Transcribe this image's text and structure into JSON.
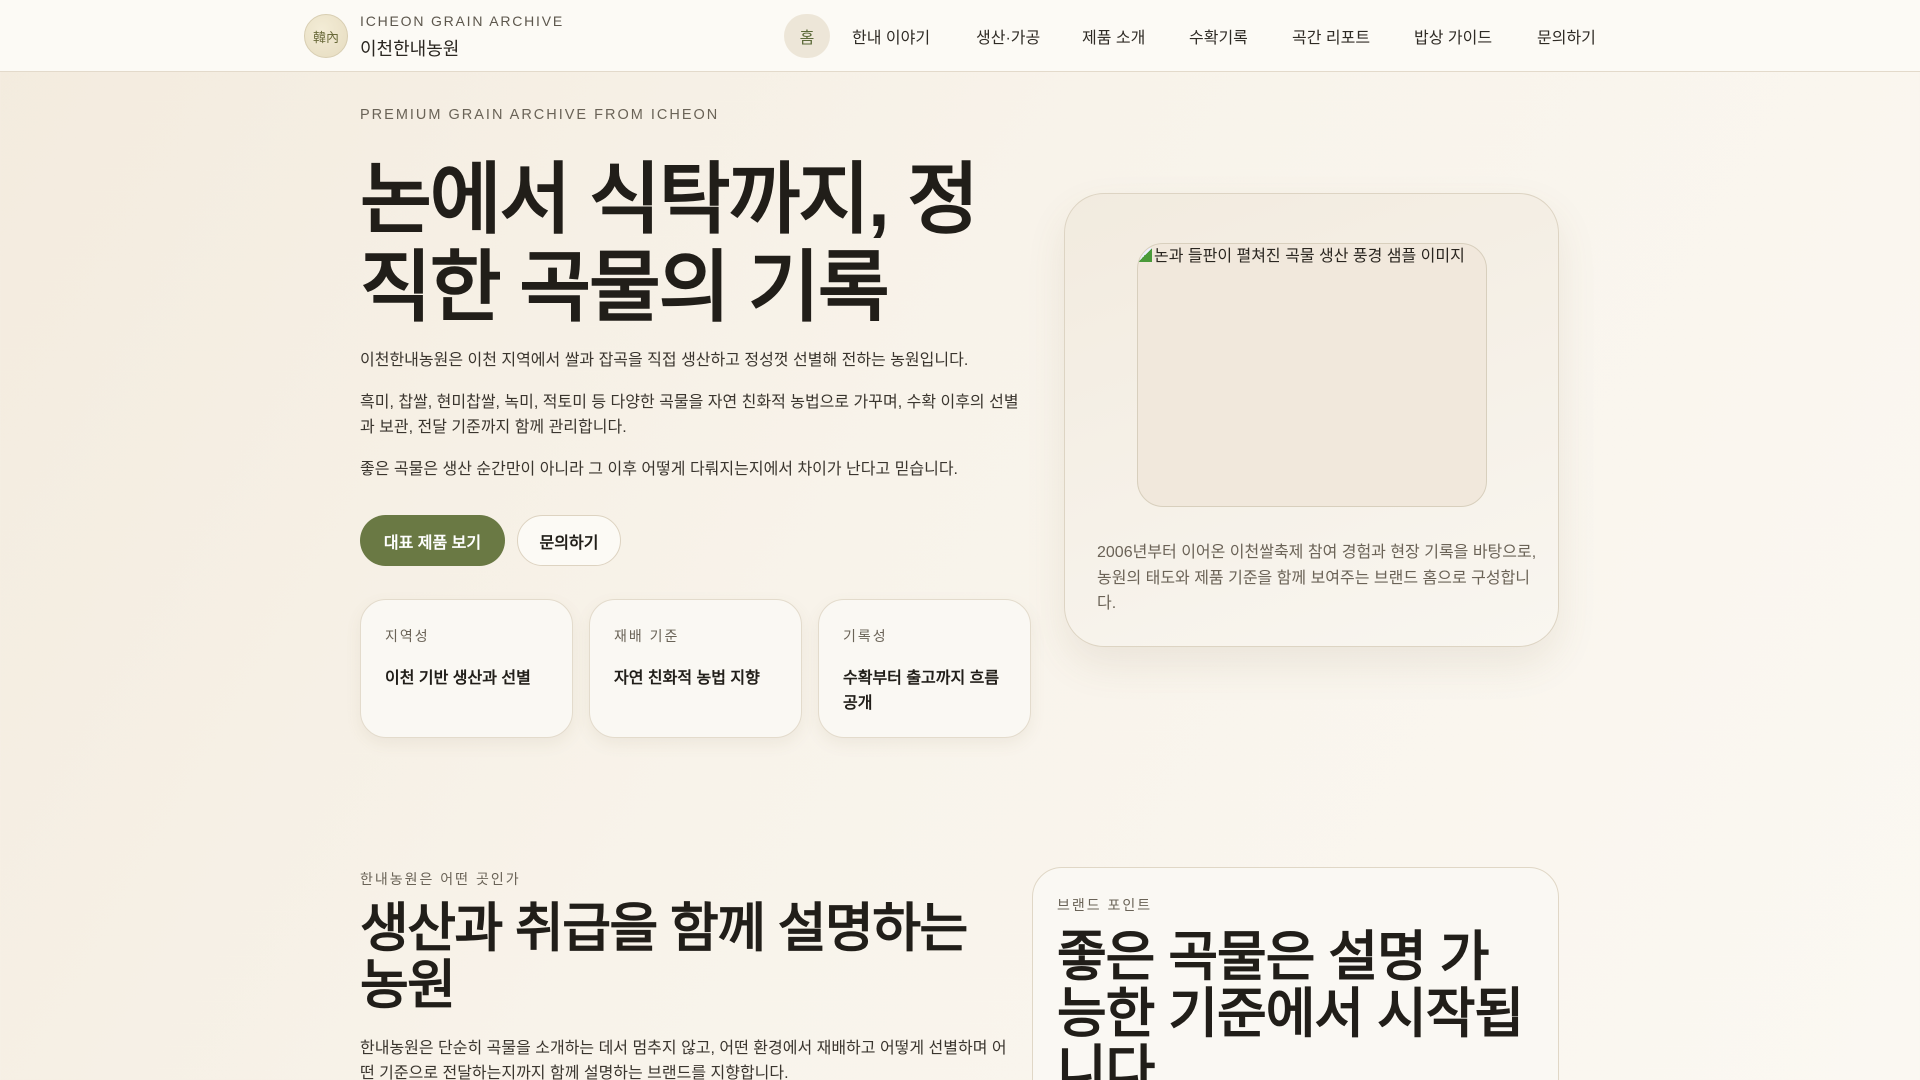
{
  "header": {
    "logo_text": "韓內",
    "brand_en": "ICHEON GRAIN ARCHIVE",
    "brand_ko": "이천한내농원",
    "nav": [
      "홈",
      "한내 이야기",
      "생산·가공",
      "제품 소개",
      "수확기록",
      "곡간 리포트",
      "밥상 가이드",
      "문의하기"
    ]
  },
  "hero": {
    "eyebrow": "PREMIUM GRAIN ARCHIVE FROM ICHEON",
    "title": "논에서 식탁까지, 정직한 곡물의 기록",
    "paragraphs": [
      "이천한내농원은 이천 지역에서 쌀과 잡곡을 직접 생산하고 정성껏 선별해 전하는 농원입니다.",
      "흑미, 찹쌀, 현미찹쌀, 녹미, 적토미 등 다양한 곡물을 자연 친화적 농법으로 가꾸며, 수확 이후의 선별과 보관, 전달 기준까지 함께 관리합니다.",
      "좋은 곡물은 생산 순간만이 아니라 그 이후 어떻게 다뤄지는지에서 차이가 난다고 믿습니다."
    ],
    "primary_button": "대표 제품 보기",
    "secondary_button": "문의하기",
    "cards": [
      {
        "label": "지역성",
        "value": "이천 기반 생산과 선별"
      },
      {
        "label": "재배 기준",
        "value": "자연 친화적 농법 지향"
      },
      {
        "label": "기록성",
        "value": "수확부터 출고까지 흐름 공개"
      }
    ],
    "image_alt": "논과 들판이 펼쳐진 곡물 생산 풍경 샘플 이미지",
    "caption": "2006년부터 이어온 이천쌀축제 참여 경험과 현장 기록을 바탕으로, 농원의 태도와 제품 기준을 함께 보여주는 브랜드 홈으로 구성합니다."
  },
  "about": {
    "eyebrow": "한내농원은 어떤 곳인가",
    "title": "생산과 취급을 함께 설명하는 농원",
    "paragraph": "한내농원은 단순히 곡물을 소개하는 데서 멈추지 않고, 어떤 환경에서 재배하고 어떻게 선별하며 어떤 기준으로 전달하는지까지 함께 설명하는 브랜드를 지향합니다.",
    "point_label": "브랜드 포인트",
    "point_title": "좋은 곡물은 설명 가능한 기준에서 시작됩니다"
  },
  "colors": {
    "accent": "#6a7944",
    "background": "#f6f0e6"
  }
}
